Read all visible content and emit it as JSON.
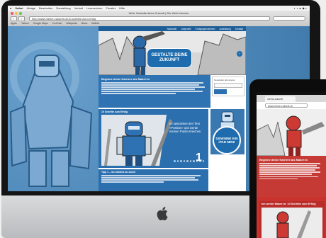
{
  "mac_menubar": {
    "app": "Safari",
    "items": [
      "Ablage",
      "Bearbeiten",
      "Darstellung",
      "Verlauf",
      "Lesezeichen",
      "Fenster",
      "Hilfe"
    ]
  },
  "browser": {
    "window_title": "Web: Gestalte deine Zukunft | Die Web-Karriere",
    "url": "http://www.meine-zukunft.ch/10-schritte-zum-erfolg",
    "bookmarks": [
      "Apple",
      "Yahoo!",
      "Google Maps",
      "YouTube",
      "Wikipedia",
      "News",
      "Beliebt"
    ]
  },
  "site": {
    "nav": [
      "Startseite",
      "Jobprofile",
      "Erfolgsgeschichten",
      "Ausbildung",
      "Kontakt"
    ],
    "hero_title_line1": "GESTALTE DEINE",
    "hero_title_line2": "ZUKUNFT",
    "hero_next": "›",
    "intro_title": "Beginne deine Karriere als Maker:in",
    "slider_title": "10 Schritte zum Erfolg",
    "slider_text": "Ich absolviere den Test «Position» und werde meinen Punkt erreichen.",
    "slider_number": "1",
    "teaser_title": "Tipp 1 – So startest du durch",
    "sidebar_newsletter": "Newsletter abonnieren",
    "sidebar_input_placeholder": "E-Mail-Adresse",
    "ipad_ad_line1": "GEWINNE EIN",
    "ipad_ad_line2": "iPAD MINI!"
  },
  "ipad": {
    "tab_label": "meine-zukunft",
    "url": "www.meine-zukunft.ch",
    "intro_title": "Beginne deine Karriere als Maker:in",
    "slider_title": "Ich werde Maker:in: 10 Schritte zum Erfolg"
  },
  "colors": {
    "site_blue": "#2c6fae",
    "ipad_red": "#c9322d"
  }
}
